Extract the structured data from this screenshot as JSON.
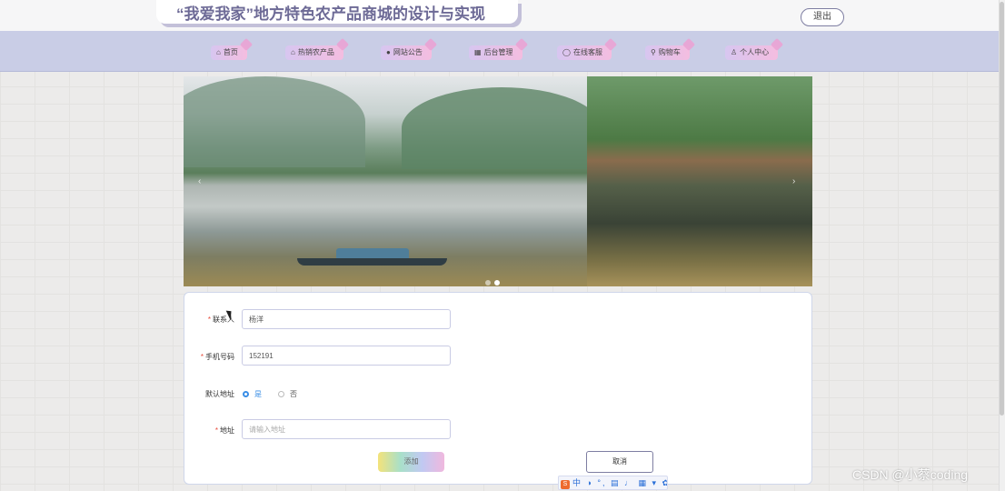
{
  "header": {
    "title": "“我爱我家”地方特色农产品商城的设计与实现",
    "logout_label": "退出"
  },
  "nav": {
    "items": [
      {
        "icon": "⌂",
        "icon_name": "home-icon",
        "label": "首页"
      },
      {
        "icon": "⌂",
        "icon_name": "shop-icon",
        "label": "热销农产品"
      },
      {
        "icon": "●",
        "icon_name": "notice-icon",
        "label": "网站公告"
      },
      {
        "icon": "▦",
        "icon_name": "admin-icon",
        "label": "后台管理"
      },
      {
        "icon": "◯",
        "icon_name": "chat-icon",
        "label": "在线客服"
      },
      {
        "icon": "⚲",
        "icon_name": "cart-icon",
        "label": "购物车"
      },
      {
        "icon": "♙",
        "icon_name": "user-icon",
        "label": "个人中心"
      }
    ]
  },
  "carousel": {
    "prev_arrow": "‹",
    "next_arrow": "›",
    "slide_count": 2,
    "active_index": 1
  },
  "form": {
    "contact": {
      "label": "联系人",
      "value": "杨洋",
      "required": true
    },
    "phone": {
      "label": "手机号码",
      "value": "152191",
      "required": true
    },
    "default_address": {
      "label": "默认地址",
      "options": [
        "是",
        "否"
      ],
      "selected": "是"
    },
    "address": {
      "label": "地址",
      "placeholder": "请输入地址",
      "value": "",
      "required": true
    },
    "submit_label": "添加",
    "cancel_label": "取消"
  },
  "ime_toolbar": {
    "logo": "S",
    "text": "中 ◑ °, ▤ ♩ ▦ ▾ ✿"
  },
  "watermark": "CSDN @小蔡coding",
  "colors": {
    "nav_bg": "#c9cde6",
    "title": "#6d6a96",
    "accent": "#3a8ee6",
    "required": "#e74c3c"
  }
}
